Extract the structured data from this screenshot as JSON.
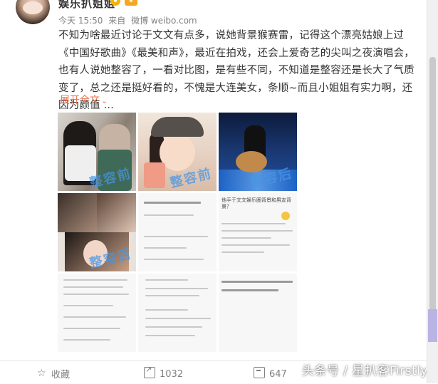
{
  "post": {
    "author": "娱乐扒姐姐",
    "meta_time": "今天 15:50",
    "meta_from": "来自",
    "meta_source": "微博 weibo.com",
    "text": "不知为啥最近讨论于文文有点多，说她背景猴赛雷，记得这个漂亮姑娘上过《中国好歌曲》《最美和声》，最近在拍戏，还会上爱奇艺的尖叫之夜演唱会，也有人说她整容了，一看对比图，是有些不同，不知道是整容还是长大了气质变了，总之还是挺好看的，不愧是大连美女，条顺~而且小姐姐有实力啊，还因为颜值 ...",
    "expand_label": "展开全文",
    "expand_icon": "chevron-down-icon",
    "image_watermark": "整容前",
    "image_watermark_after": "整容后"
  },
  "images": [
    {
      "name": "image-1",
      "kind": "photo"
    },
    {
      "name": "image-2",
      "kind": "photo"
    },
    {
      "name": "image-3",
      "kind": "photo"
    },
    {
      "name": "image-4",
      "kind": "photo"
    },
    {
      "name": "image-5",
      "kind": "text-screenshot"
    },
    {
      "name": "image-6",
      "kind": "text-screenshot",
      "text": "他手于文文娱乐圈背景和男友背景？"
    },
    {
      "name": "image-7",
      "kind": "text-screenshot"
    },
    {
      "name": "image-8",
      "kind": "text-screenshot"
    },
    {
      "name": "image-9",
      "kind": "text-screenshot"
    }
  ],
  "actions": {
    "favorite_label": "收藏",
    "share_count": "1032",
    "comment_count": "647"
  },
  "brand_watermark": "头条号 / 星扒客Firstly",
  "colors": {
    "link": "#eb7350",
    "meta": "#808080",
    "text": "#333333",
    "watermark_blue": "#4696e6"
  }
}
